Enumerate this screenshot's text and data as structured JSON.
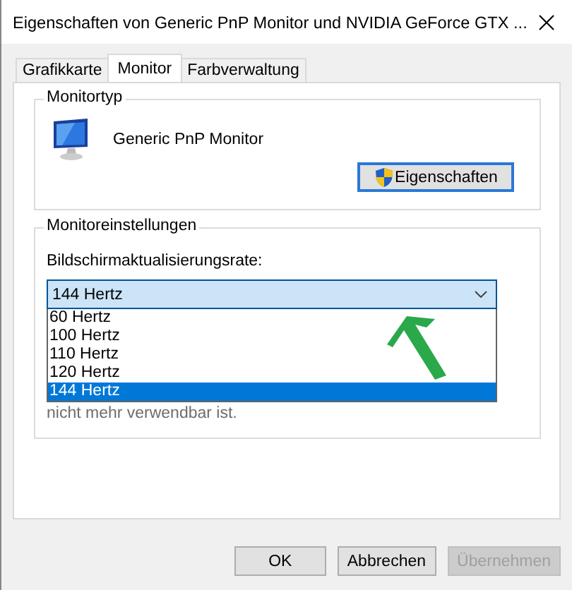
{
  "window": {
    "title": "Eigenschaften von Generic PnP Monitor und NVIDIA GeForce GTX ..."
  },
  "tabs": [
    {
      "label": "Grafikkarte",
      "selected": false
    },
    {
      "label": "Monitor",
      "selected": true
    },
    {
      "label": "Farbverwaltung",
      "selected": false
    }
  ],
  "monitor_type": {
    "legend": "Monitortyp",
    "name": "Generic PnP Monitor",
    "button": "Eigenschaften"
  },
  "monitor_settings": {
    "legend": "Monitoreinstellungen",
    "refresh_label": "Bildschirmaktualisierungsrate:",
    "dropdown": {
      "value": "144 Hertz",
      "expanded": true,
      "options": [
        {
          "label": "60 Hertz",
          "selected": false
        },
        {
          "label": "100 Hertz",
          "selected": false
        },
        {
          "label": "110 Hertz",
          "selected": false
        },
        {
          "label": "120 Hertz",
          "selected": false
        },
        {
          "label": "144 Hertz",
          "selected": true
        }
      ]
    },
    "note": "nicht mehr verwendbar ist."
  },
  "buttons": [
    {
      "label": "OK",
      "disabled": false
    },
    {
      "label": "Abbrechen",
      "disabled": false
    },
    {
      "label": "Übernehmen",
      "disabled": true
    }
  ]
}
